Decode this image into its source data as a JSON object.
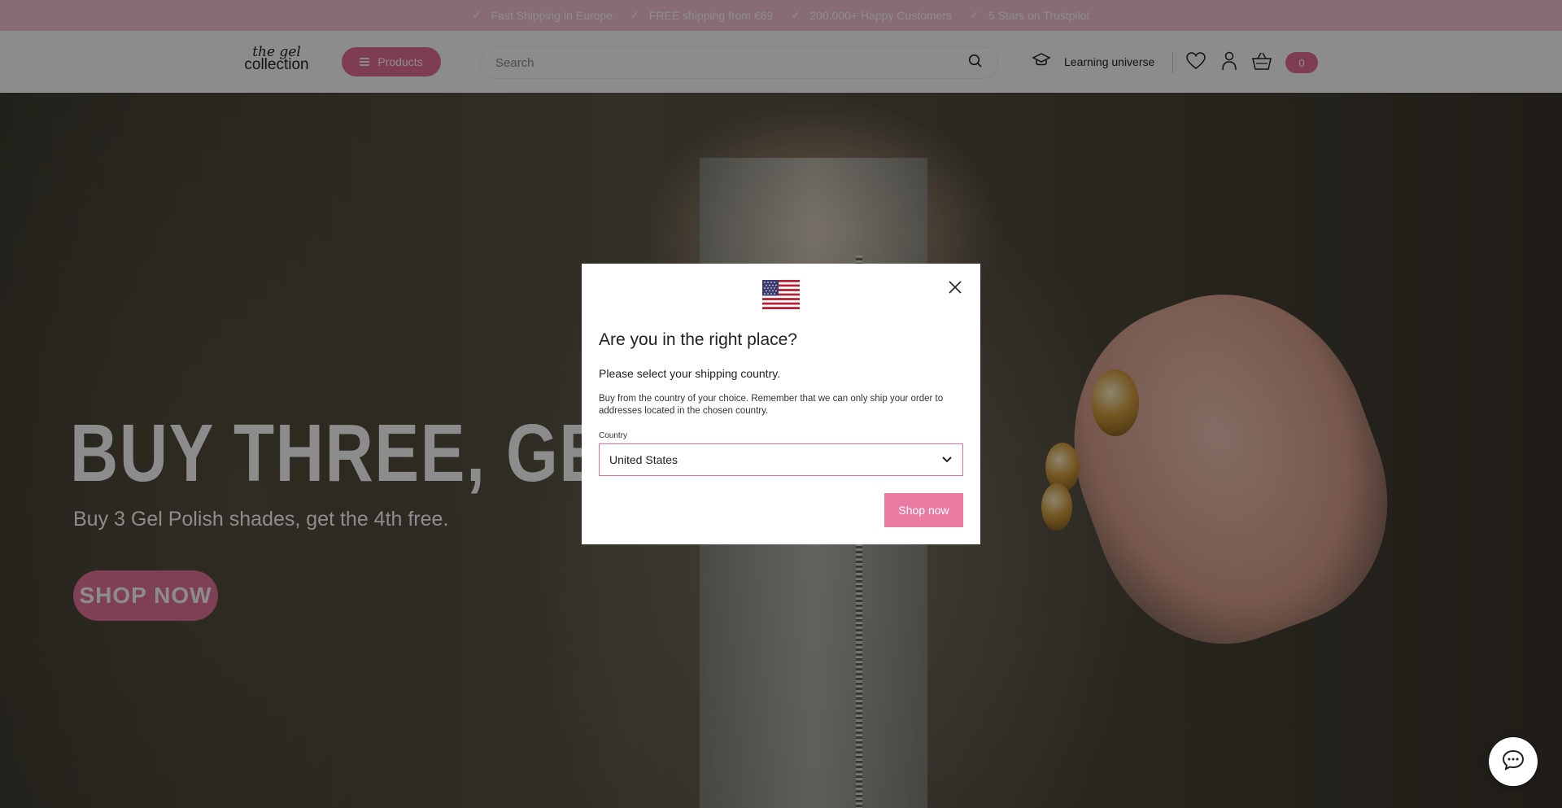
{
  "announcement": {
    "items": [
      "Fast Shipping in Europe",
      "FREE shipping from €69",
      "200.000+ Happy Customers",
      "5 Stars on Trustpilot"
    ]
  },
  "header": {
    "logo_line1": "the gel",
    "logo_line2": "collection",
    "products_label": "Products",
    "search_placeholder": "Search",
    "learning_label": "Learning universe",
    "cart_count": "0"
  },
  "hero": {
    "title": "BUY THREE, GET",
    "subtitle": "Buy 3 Gel Polish shades, get the 4th free.",
    "cta": "SHOP NOW"
  },
  "modal": {
    "title": "Are you in the right place?",
    "subtitle": "Please select your shipping country.",
    "description": "Buy from the country of your choice. Remember that we can only ship your order to addresses located in the chosen country.",
    "country_label": "Country",
    "country_value": "United States",
    "button": "Shop now"
  },
  "colors": {
    "brand_pink": "#e66f96",
    "announcement_bg": "#f7c5d3"
  },
  "icons": [
    "check-icon",
    "menu-icon",
    "search-icon",
    "graduation-cap-icon",
    "heart-icon",
    "user-icon",
    "basket-icon",
    "us-flag-icon",
    "close-icon",
    "chevron-down-icon",
    "chat-icon"
  ]
}
